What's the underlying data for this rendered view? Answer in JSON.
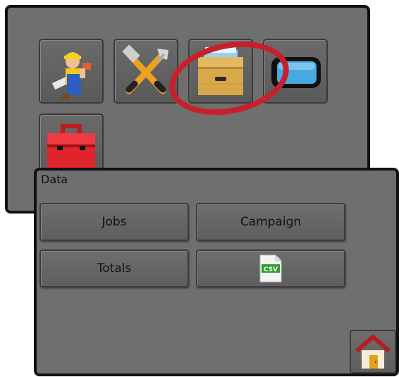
{
  "main_menu": {
    "icons": [
      "worker-icon",
      "tools-icon",
      "file-cabinet-icon",
      "console-screen-icon",
      "toolbox-icon"
    ]
  },
  "data_panel": {
    "title": "Data",
    "buttons": {
      "jobs": "Jobs",
      "campaign": "Campaign",
      "totals": "Totals"
    },
    "csv_icon_label": "CSV",
    "home_icon": "home-icon"
  },
  "colors": {
    "panel_bg": "#6f6f6f",
    "highlight_ring": "#c8202a",
    "toolbox_red": "#e0242c",
    "cabinet_tan": "#d8a84a",
    "screen_blue": "#48a8e0",
    "csv_green": "#2e9e2e"
  }
}
